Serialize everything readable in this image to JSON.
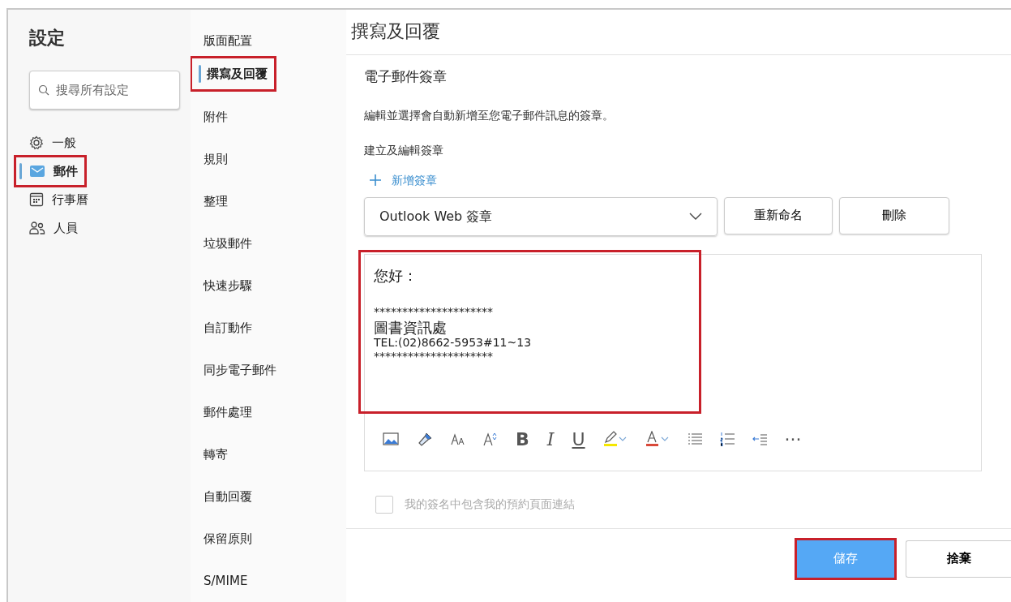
{
  "settings": {
    "title": "設定",
    "search": {
      "placeholder": "搜尋所有設定"
    },
    "nav": [
      {
        "label": "一般",
        "kind": "gear",
        "selected": false,
        "highlighted": false
      },
      {
        "label": "郵件",
        "kind": "mail",
        "selected": true,
        "highlighted": true
      },
      {
        "label": "行事曆",
        "kind": "calendar",
        "selected": false,
        "highlighted": false
      },
      {
        "label": "人員",
        "kind": "people",
        "selected": false,
        "highlighted": false
      }
    ]
  },
  "subnav": [
    {
      "label": "版面配置",
      "selected": false,
      "highlighted": false
    },
    {
      "label": "撰寫及回覆",
      "selected": true,
      "highlighted": true
    },
    {
      "label": "附件",
      "selected": false,
      "highlighted": false
    },
    {
      "label": "規則",
      "selected": false,
      "highlighted": false
    },
    {
      "label": "整理",
      "selected": false,
      "highlighted": false
    },
    {
      "label": "垃圾郵件",
      "selected": false,
      "highlighted": false
    },
    {
      "label": "快速步驟",
      "selected": false,
      "highlighted": false
    },
    {
      "label": "自訂動作",
      "selected": false,
      "highlighted": false
    },
    {
      "label": "同步電子郵件",
      "selected": false,
      "highlighted": false
    },
    {
      "label": "郵件處理",
      "selected": false,
      "highlighted": false
    },
    {
      "label": "轉寄",
      "selected": false,
      "highlighted": false
    },
    {
      "label": "自動回覆",
      "selected": false,
      "highlighted": false
    },
    {
      "label": "保留原則",
      "selected": false,
      "highlighted": false
    },
    {
      "label": "S/MIME",
      "selected": false,
      "highlighted": false
    }
  ],
  "page": {
    "title": "撰寫及回覆",
    "section_title": "電子郵件簽章",
    "description": "編輯並選擇會自動新增至您電子郵件訊息的簽章。",
    "create_label": "建立及編輯簽章",
    "add_button": "新增簽章",
    "signature_select": {
      "value": "Outlook Web 簽章"
    },
    "rename_button": "重新命名",
    "delete_button": "刪除",
    "signature": {
      "highlighted": true,
      "lines": [
        {
          "kind": "large",
          "text": "您好："
        },
        {
          "kind": "blank"
        },
        {
          "kind": "small",
          "text": "*********************"
        },
        {
          "kind": "large",
          "text": "圖書資訊處"
        },
        {
          "kind": "small",
          "text": "TEL:(02)8662-5953#11~13"
        },
        {
          "kind": "small",
          "text": "*********************"
        }
      ]
    },
    "toolbar": [
      {
        "kind": "picture"
      },
      {
        "kind": "painter"
      },
      {
        "kind": "font-size"
      },
      {
        "kind": "grow"
      },
      {
        "kind": "bold",
        "label": "B"
      },
      {
        "kind": "italic",
        "label": "I"
      },
      {
        "kind": "underline",
        "label": "U"
      },
      {
        "kind": "highlight"
      },
      {
        "kind": "font-color"
      },
      {
        "kind": "bullets"
      },
      {
        "kind": "numbers"
      },
      {
        "kind": "outdent"
      },
      {
        "kind": "more",
        "label": "···"
      }
    ],
    "booking_checkbox": {
      "label": "我的簽名中包含我的預約頁面連結",
      "checked": false,
      "disabled": true
    },
    "save_button": {
      "label": "儲存",
      "highlighted": true
    },
    "discard_button": {
      "label": "捨棄"
    }
  }
}
